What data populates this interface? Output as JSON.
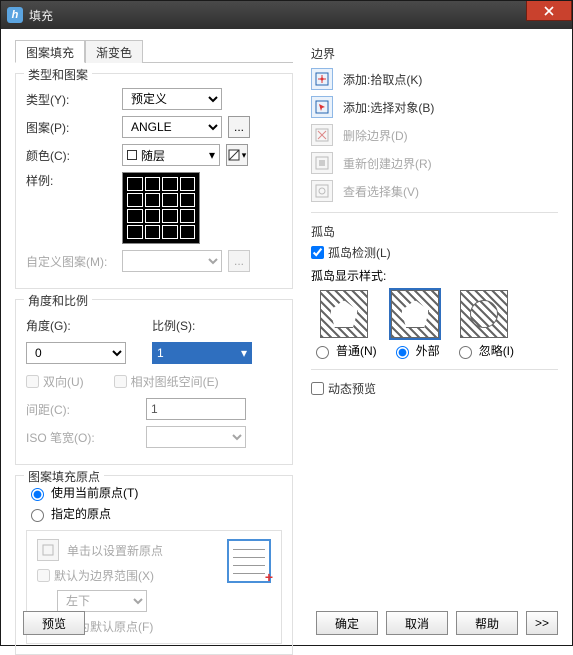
{
  "window": {
    "title": "填充"
  },
  "tabs": {
    "active": "图案填充",
    "inactive": "渐变色"
  },
  "type_group": {
    "legend": "类型和图案",
    "type_label": "类型(Y):",
    "type_value": "预定义",
    "pattern_label": "图案(P):",
    "pattern_value": "ANGLE",
    "color_label": "颜色(C):",
    "color_value": "随层",
    "sample_label": "样例:",
    "custom_label": "自定义图案(M):"
  },
  "angle_group": {
    "legend": "角度和比例",
    "angle_label": "角度(G):",
    "angle_value": "0",
    "scale_label": "比例(S):",
    "scale_value": "1",
    "bidir_label": "双向(U)",
    "relpaper_label": "相对图纸空间(E)",
    "spacing_label": "间距(C):",
    "spacing_value": "1",
    "iso_label": "ISO 笔宽(O):"
  },
  "origin_group": {
    "legend": "图案填充原点",
    "use_current": "使用当前原点(T)",
    "specify": "指定的原点",
    "click_new": "单击以设置新原点",
    "default_bound": "默认为边界范围(X)",
    "pos_value": "左下",
    "store_default": "存储为默认原点(F)"
  },
  "boundary": {
    "title": "边界",
    "add_pick": "添加:拾取点(K)",
    "add_select": "添加:选择对象(B)",
    "remove": "删除边界(D)",
    "recreate": "重新创建边界(R)",
    "view_sel": "查看选择集(V)"
  },
  "island": {
    "title": "孤岛",
    "detect_label": "孤岛检测(L)",
    "display_label": "孤岛显示样式:",
    "opt_normal": "普通(N)",
    "opt_outer": "外部",
    "opt_ignore": "忽略(I)"
  },
  "dynamic_preview": "动态预览",
  "footer": {
    "preview": "预览",
    "ok": "确定",
    "cancel": "取消",
    "help": "帮助",
    "expand": ">>"
  }
}
